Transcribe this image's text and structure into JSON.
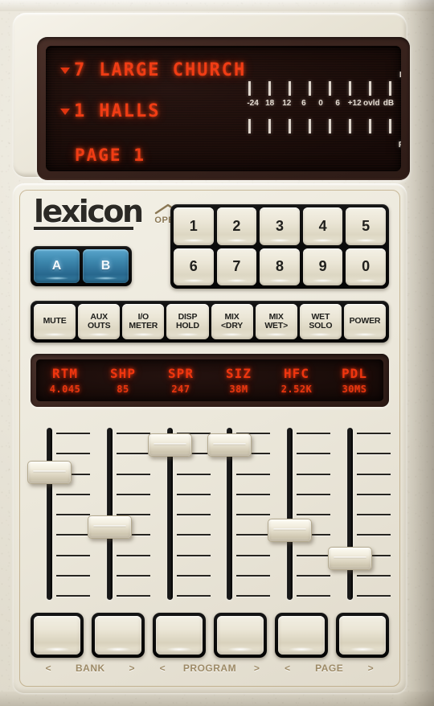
{
  "device": {
    "brand": "lexicon",
    "open_label": "OPEN",
    "open_icon": "chevron-up-icon"
  },
  "display": {
    "program": {
      "marker": "triangle-down-icon",
      "number": "7",
      "name": "LARGE CHURCH"
    },
    "bank": {
      "marker": "triangle-down-icon",
      "number": "1",
      "name": "HALLS"
    },
    "page_text": "PAGE 1"
  },
  "meter": {
    "channel_top": "L",
    "channel_bottom": "R",
    "scale": [
      "-24",
      "18",
      "12",
      "6",
      "0",
      "6",
      "+12",
      "ovld",
      "dB"
    ],
    "tick_count": 8
  },
  "ab_buttons": [
    {
      "label": "A",
      "active": true
    },
    {
      "label": "B",
      "active": true
    }
  ],
  "keypad": {
    "row1": [
      "1",
      "2",
      "3",
      "4",
      "5"
    ],
    "row2": [
      "6",
      "7",
      "8",
      "9",
      "0"
    ]
  },
  "function_buttons": [
    {
      "line1": "MUTE",
      "line2": ""
    },
    {
      "line1": "AUX",
      "line2": "OUTS"
    },
    {
      "line1": "I/O",
      "line2": "METER"
    },
    {
      "line1": "DISP",
      "line2": "HOLD"
    },
    {
      "line1": "MIX",
      "line2": "<DRY"
    },
    {
      "line1": "MIX",
      "line2": "WET>"
    },
    {
      "line1": "WET",
      "line2": "SOLO"
    },
    {
      "line1": "POWER",
      "line2": ""
    }
  ],
  "parameters": [
    {
      "name": "RTM",
      "value": "4.045"
    },
    {
      "name": "SHP",
      "value": "85"
    },
    {
      "name": "SPR",
      "value": "247"
    },
    {
      "name": "SIZ",
      "value": "38M"
    },
    {
      "name": "HFC",
      "value": "2.52K"
    },
    {
      "name": "PDL",
      "value": "30MS"
    }
  ],
  "faders": [
    {
      "param": "RTM",
      "position_pct": 22
    },
    {
      "param": "SHP",
      "position_pct": 59
    },
    {
      "param": "SPR",
      "position_pct": 4
    },
    {
      "param": "SIZ",
      "position_pct": 4
    },
    {
      "param": "HFC",
      "position_pct": 61
    },
    {
      "param": "PDL",
      "position_pct": 80
    }
  ],
  "bottom_label_groups": [
    {
      "left_arrow": "<",
      "word": "BANK",
      "right_arrow": ">",
      "tight": false
    },
    {
      "left_arrow": "<",
      "word": "PROGRAM",
      "right_arrow": ">",
      "tight": true
    },
    {
      "left_arrow": "<",
      "word": "PAGE",
      "right_arrow": ">",
      "tight": false
    }
  ],
  "colors": {
    "led_red": "#f0360f",
    "panel_cream": "#ebe7da",
    "ab_blue": "#3d87ae",
    "label_tan": "#9d8a66"
  }
}
